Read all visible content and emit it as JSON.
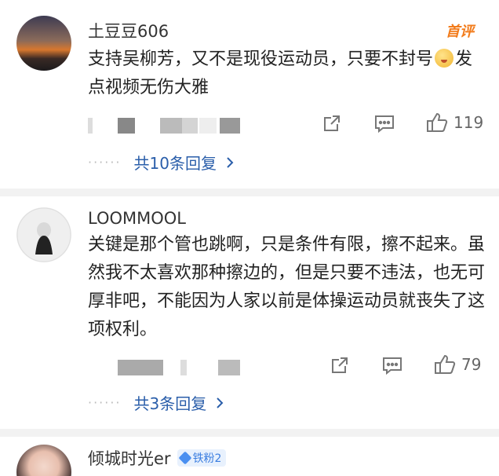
{
  "comments": [
    {
      "username": "土豆豆606",
      "badge": "首评",
      "text_before_emoji": "支持吴柳芳，又不是现役运动员，只要不封号",
      "emoji": "smiling-face-emoji",
      "text_after_emoji": "发点视频无伤大雅",
      "likes": "119",
      "replies_label": "共10条回复"
    },
    {
      "username": "LOOMMOOL",
      "text": "关键是那个管也跳啊，只是条件有限，擦不起来。虽然我不太喜欢那种擦边的，但是只要不违法，也无可厚非吧，不能因为人家以前是体操运动员就丧失了这项权利。",
      "likes": "79",
      "replies_label": "共3条回复"
    },
    {
      "username": "倾城时光er",
      "fan_badge": "铁粉2"
    }
  ],
  "icons": {
    "share": "share-icon",
    "comment": "comment-icon",
    "like": "thumbs-up-icon",
    "chevron": "chevron-right-icon"
  },
  "colors": {
    "link": "#2a5eaa",
    "hot_badge": "#f27b1a",
    "fan_badge": "#3a7de0"
  }
}
